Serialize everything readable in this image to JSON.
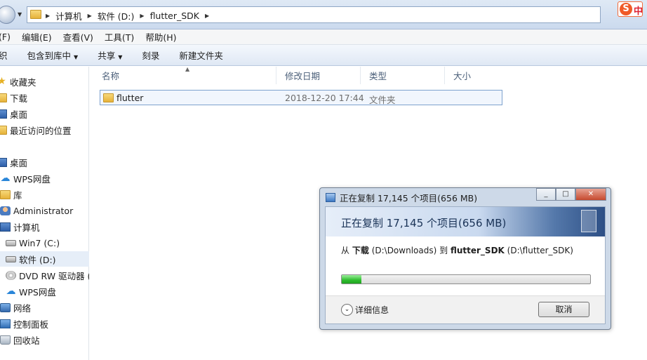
{
  "address": {
    "crumbs": [
      "计算机",
      "软件 (D:)",
      "flutter_SDK"
    ]
  },
  "menubar": [
    "(F)",
    "编辑(E)",
    "查看(V)",
    "工具(T)",
    "帮助(H)"
  ],
  "toolbar": {
    "organize": "织",
    "include_library": "包含到库中",
    "share": "共享",
    "burn": "刻录",
    "new_folder": "新建文件夹"
  },
  "sidebar": {
    "items": [
      {
        "label": "收藏夹",
        "icon": "star-icon"
      },
      {
        "label": "下载",
        "icon": "folder-icon"
      },
      {
        "label": "桌面",
        "icon": "monitor-icon"
      },
      {
        "label": "最近访问的位置",
        "icon": "folder-icon"
      },
      {
        "label": "桌面",
        "icon": "monitor-icon"
      },
      {
        "label": "WPS网盘",
        "icon": "cloud-icon"
      },
      {
        "label": "库",
        "icon": "folder-icon"
      },
      {
        "label": "Administrator",
        "icon": "user-icon"
      },
      {
        "label": "计算机",
        "icon": "monitor-icon"
      },
      {
        "label": "Win7 (C:)",
        "icon": "drive-icon"
      },
      {
        "label": "软件 (D:)",
        "icon": "drive-icon"
      },
      {
        "label": "DVD RW 驱动器 (",
        "icon": "dvd-icon"
      },
      {
        "label": "WPS网盘",
        "icon": "cloud-icon"
      },
      {
        "label": "网络",
        "icon": "network-icon"
      },
      {
        "label": "控制面板",
        "icon": "control-panel-icon"
      },
      {
        "label": "回收站",
        "icon": "trash-icon"
      }
    ]
  },
  "columns": {
    "name": "名称",
    "modified": "修改日期",
    "type": "类型",
    "size": "大小"
  },
  "files": [
    {
      "name": "flutter",
      "modified": "2018-12-20 17:44",
      "type": "文件夹"
    }
  ],
  "copy_dialog": {
    "title": "正在复制 17,145 个项目(656 MB)",
    "heading": "正在复制 17,145 个项目(656 MB)",
    "from_prefix": "从",
    "from_name": "下载",
    "from_path": "(D:\\Downloads)",
    "to_prefix": "到",
    "to_name": "flutter_SDK",
    "to_path": "(D:\\flutter_SDK)",
    "progress": 0.08,
    "details_label": "详细信息",
    "cancel_label": "取消"
  },
  "ime": {
    "badge": "S",
    "label": "中"
  },
  "colors": {
    "progress": "#2ebd2e",
    "selection": "#e6eef8",
    "accent": "#2d4f85"
  }
}
